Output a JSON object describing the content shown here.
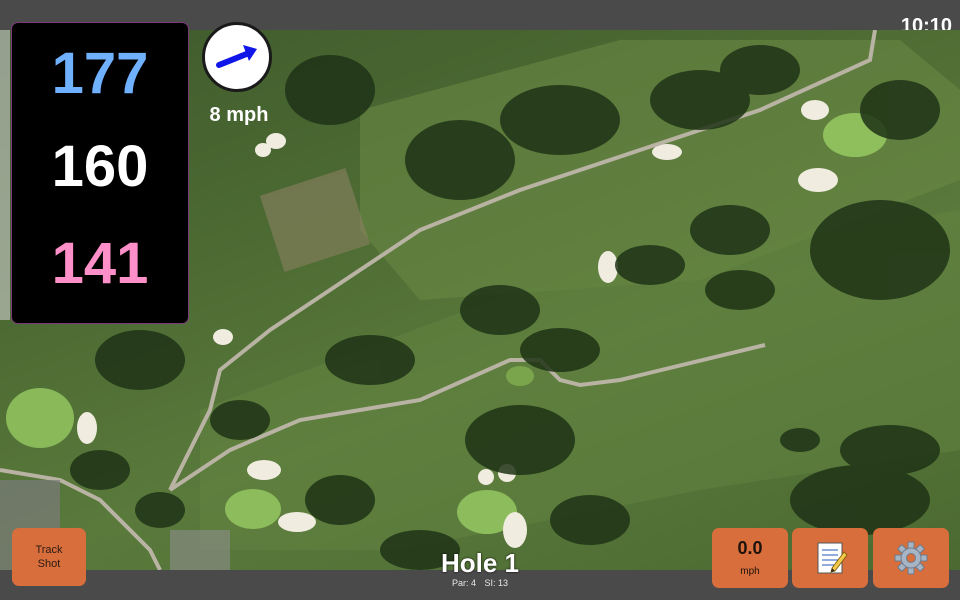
{
  "status": {
    "time": "10:10"
  },
  "distances": {
    "back": "177",
    "center": "160",
    "front": "141",
    "colors": {
      "back": "#6fb1ff",
      "center": "#ffffff",
      "front": "#ff8fc8"
    }
  },
  "wind": {
    "speed": "8 mph",
    "direction_icon": "arrow-icon",
    "arrow_color": "#1016e8"
  },
  "track_shot": {
    "line1": "Track",
    "line2": "Shot"
  },
  "hole": {
    "title": "Hole 1",
    "par": "Par: 4",
    "si": "SI: 13"
  },
  "speed_button": {
    "value": "0.0",
    "unit": "mph"
  },
  "notes_button": {
    "icon": "notepad-icon"
  },
  "settings_button": {
    "icon": "gear-icon"
  },
  "theme": {
    "button_color": "#d76e3c",
    "panel_border": "#7a3a7a"
  }
}
